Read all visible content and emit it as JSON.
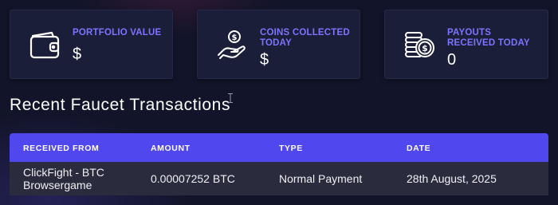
{
  "cards": [
    {
      "title": "PORTFOLIO VALUE",
      "value": "$",
      "icon": "wallet-icon"
    },
    {
      "title_line1": "COINS COLLECTED",
      "title_line2": "TODAY",
      "value": "$",
      "icon": "hand-coin-icon"
    },
    {
      "title_line1": "PAYOUTS",
      "title_line2": "RECEIVED TODAY",
      "value": "0",
      "icon": "coin-stack-icon"
    }
  ],
  "section_title": "Recent Faucet Transactions",
  "table": {
    "headers": [
      "RECEIVED FROM",
      "AMOUNT",
      "TYPE",
      "DATE"
    ],
    "rows": [
      {
        "received_from_line1": "ClickFight - BTC",
        "received_from_line2": "Browsergame",
        "amount": "0.00007252 BTC",
        "type": "Normal Payment",
        "date": "28th August, 2025"
      }
    ]
  },
  "colors": {
    "background": "#121429",
    "card_bg": "#1b1e38",
    "accent": "#7c74ff",
    "table_header": "#5147ee",
    "table_row": "#2a2c3e"
  }
}
